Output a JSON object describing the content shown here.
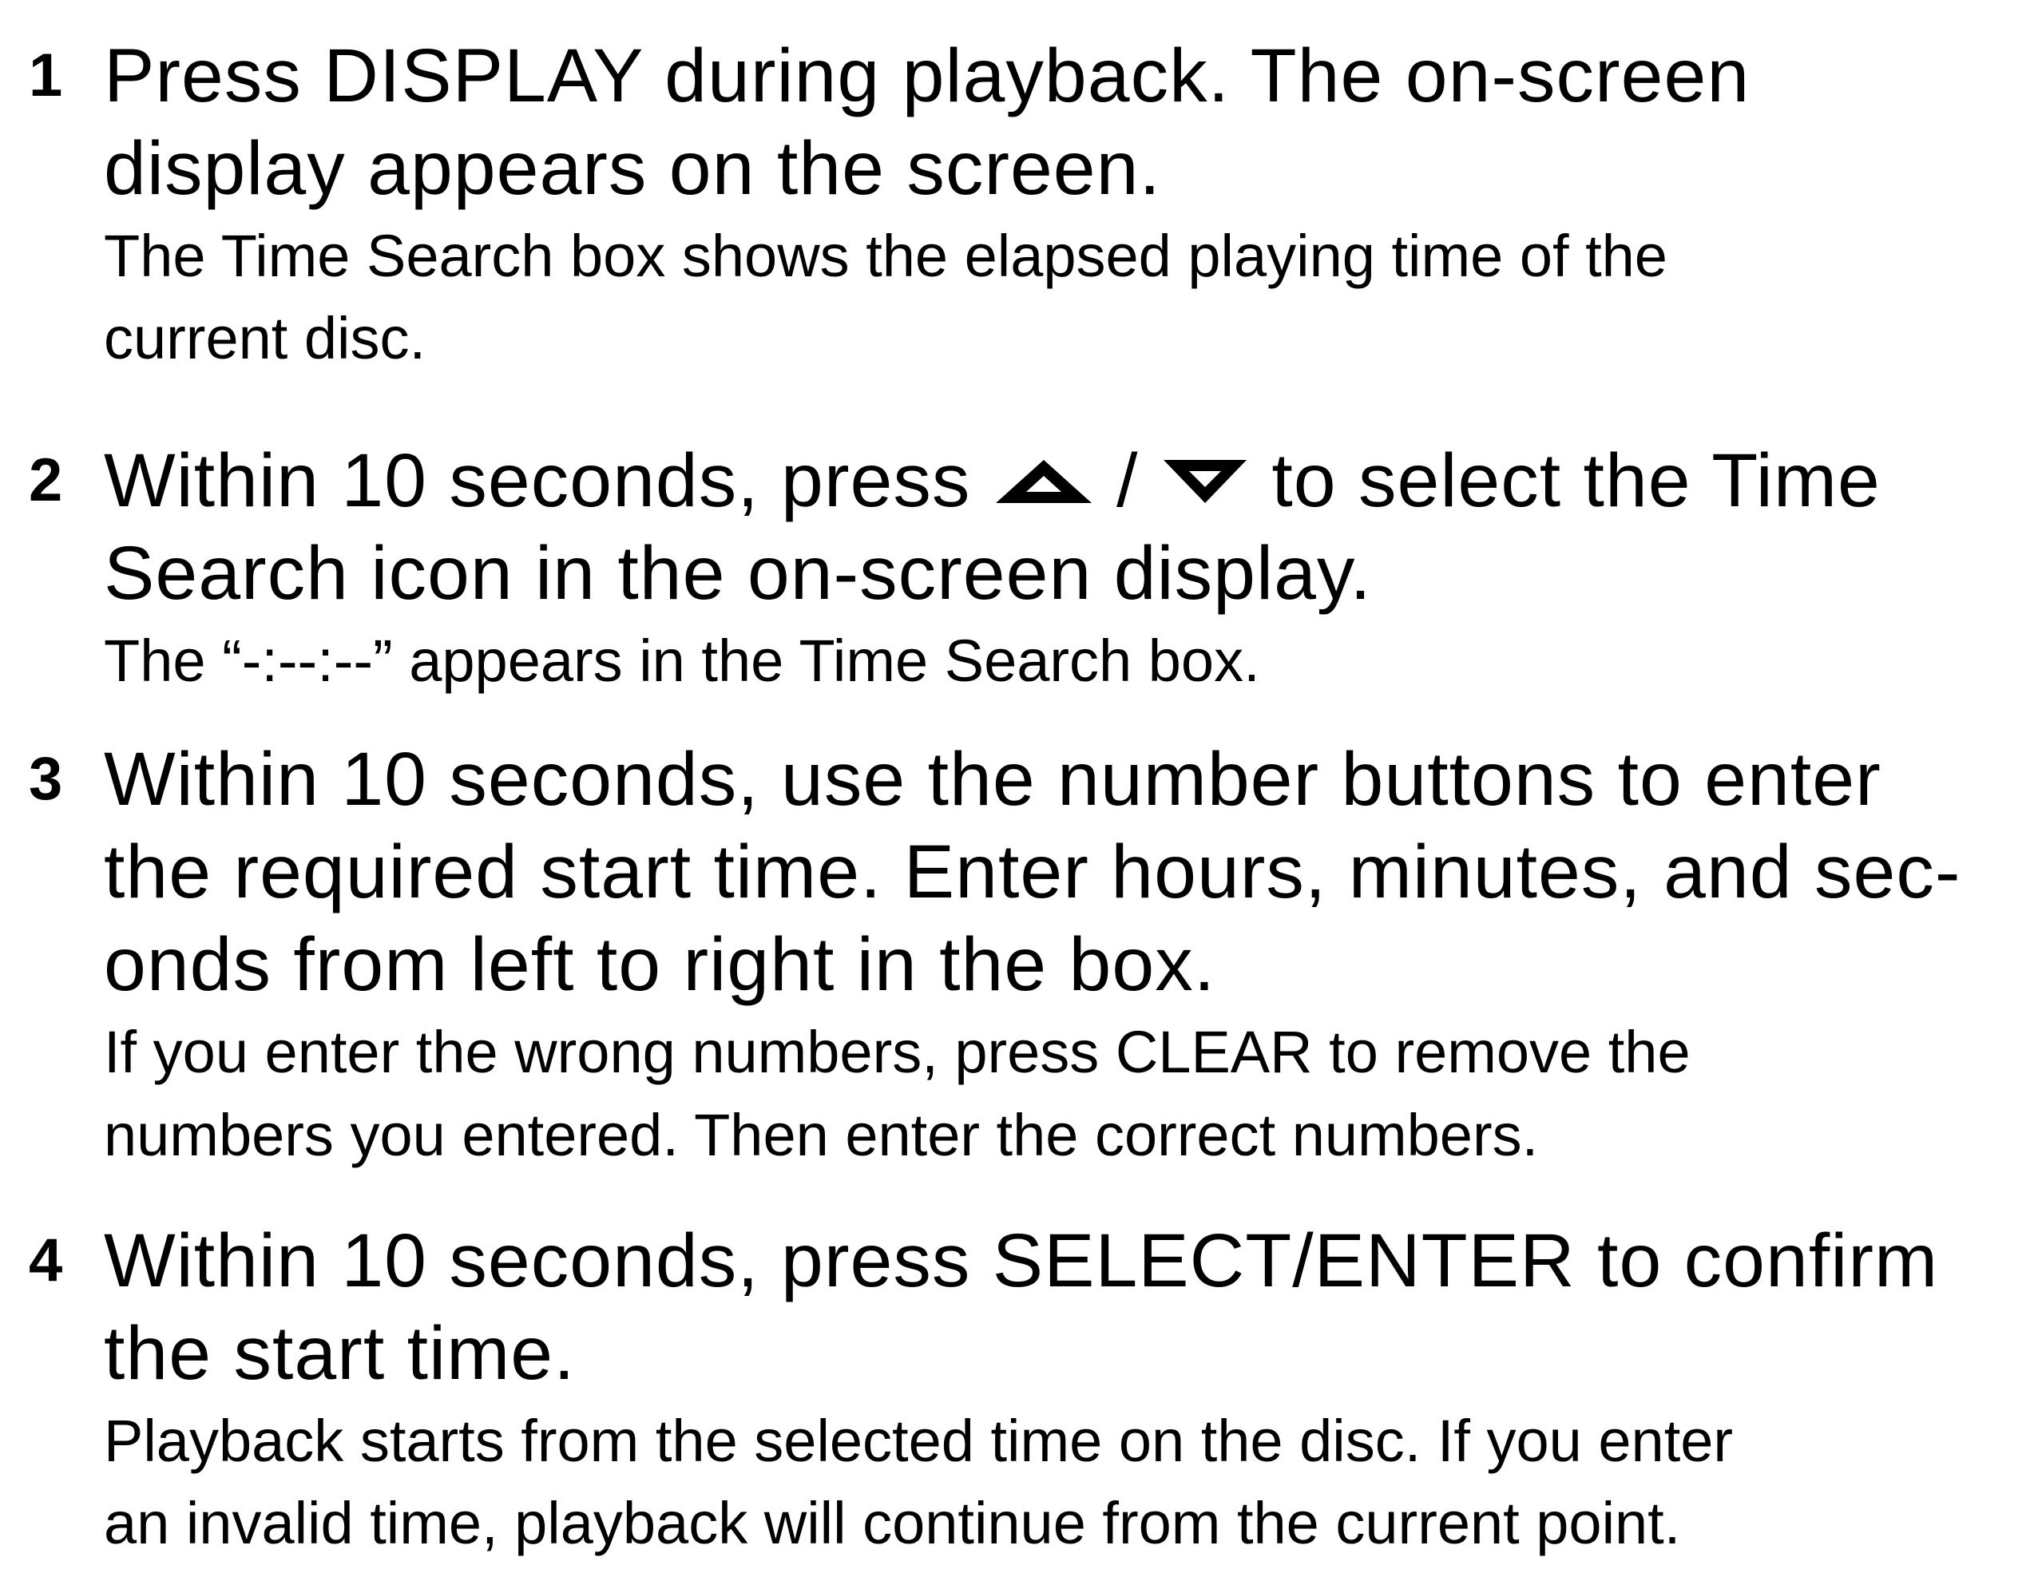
{
  "steps": [
    {
      "number": "1",
      "lines": [
        "Press DISPLAY during playback. The on-screen",
        "display appears on the screen."
      ],
      "note": [
        "The Time Search box shows the elapsed playing time of the",
        "current disc."
      ]
    },
    {
      "number": "2",
      "line1_before": "Within 10 seconds, press",
      "line1_separator": "/",
      "line1_after": "to select the Time",
      "line1_icons": [
        "up-arrow-icon",
        "down-arrow-icon"
      ],
      "lines": [
        "Search icon in the on-screen display."
      ],
      "note": [
        "The “-:--:--” appears in the Time Search box."
      ]
    },
    {
      "number": "3",
      "lines": [
        "Within 10 seconds, use the number buttons to enter",
        "the required start time. Enter hours, minutes, and sec-",
        "onds from left to right in the box."
      ],
      "note": [
        "If you enter the wrong numbers, press CLEAR to remove the",
        "numbers you entered. Then enter the correct numbers."
      ]
    },
    {
      "number": "4",
      "lines": [
        "Within 10 seconds, press SELECT/ENTER to confirm",
        "the start time."
      ],
      "note": [
        "Playback starts from the selected time on the disc. If you enter",
        "an invalid time, playback will continue from the current point."
      ]
    }
  ]
}
